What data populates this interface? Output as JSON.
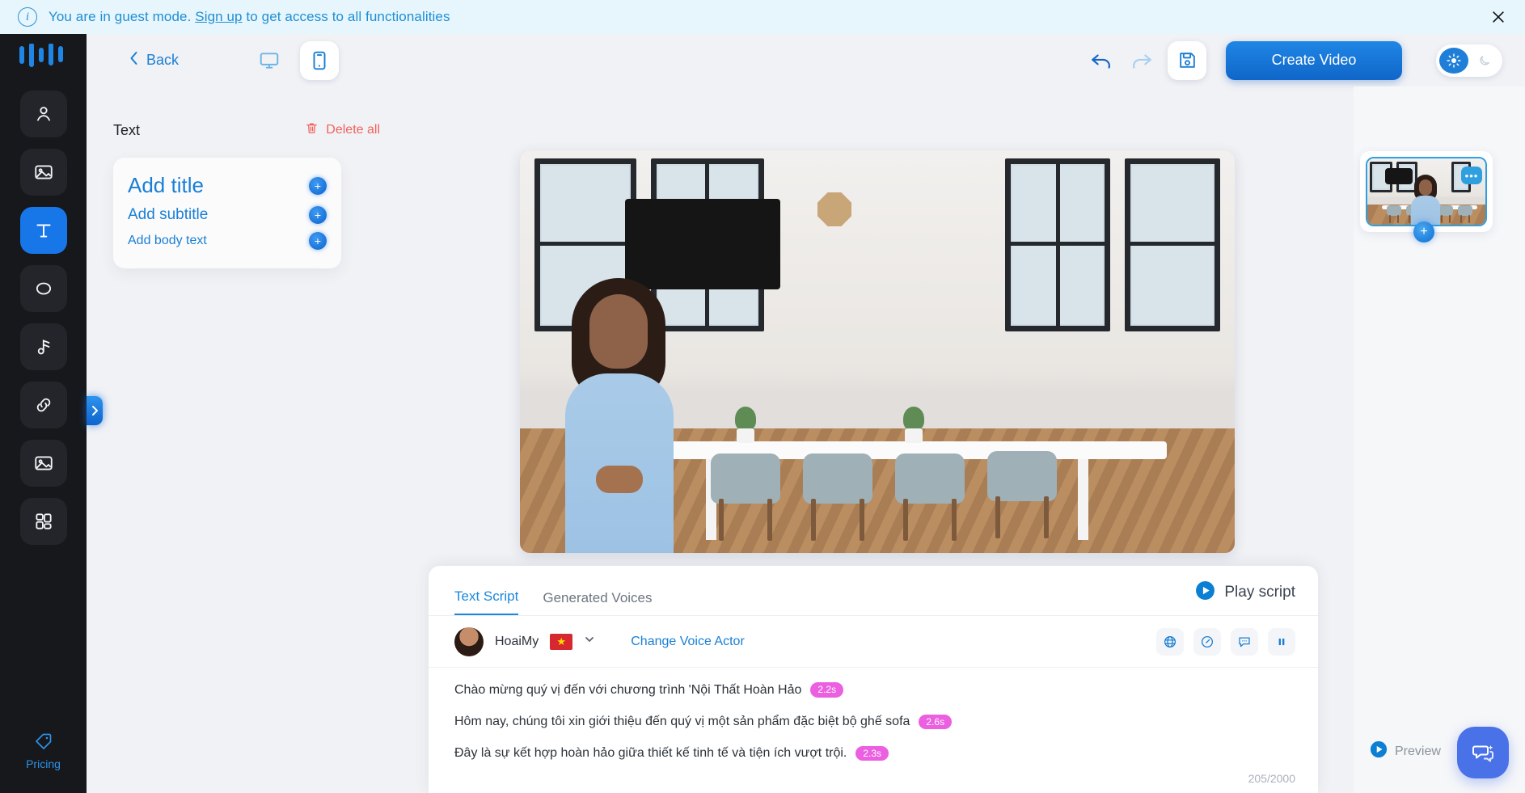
{
  "banner": {
    "icon": "info-icon",
    "text_before": "You are in guest mode. ",
    "link": "Sign up",
    "text_after": " to get access to all functionalities",
    "close_icon": "close-icon",
    "bg": "#e7f5fd",
    "fg": "#1f8fd4"
  },
  "rail": {
    "logo": "waveform-logo",
    "items": [
      {
        "name": "avatar-icon",
        "label": "Avatar",
        "active": false
      },
      {
        "name": "image-icon",
        "label": "Background",
        "active": false
      },
      {
        "name": "text-icon",
        "label": "Text",
        "active": true
      },
      {
        "name": "shape-icon",
        "label": "Shape",
        "active": false
      },
      {
        "name": "music-icon",
        "label": "Music",
        "active": false
      },
      {
        "name": "link-icon",
        "label": "Link",
        "active": false
      },
      {
        "name": "media-icon",
        "label": "Media",
        "active": false
      },
      {
        "name": "apps-icon",
        "label": "Elements",
        "active": false
      }
    ],
    "bottom": {
      "icon": "price-tag-icon",
      "label": "Pricing",
      "color": "#2e92e8"
    }
  },
  "toolbar": {
    "back_label": "Back",
    "back_icon": "chevron-left-icon",
    "devices": [
      {
        "name": "desktop-icon",
        "selected": false
      },
      {
        "name": "mobile-icon",
        "selected": true
      }
    ],
    "undo_icon": "undo-icon",
    "redo_icon": "redo-icon",
    "save_icon": "save-icon",
    "create_video_label": "Create Video",
    "theme": {
      "light_icon": "sun-icon",
      "dark_icon": "moon-icon",
      "selected": "light"
    },
    "accent": "#1877e8"
  },
  "text_panel": {
    "title": "Text",
    "delete_all_label": "Delete all",
    "delete_icon": "trash-icon",
    "items": [
      {
        "label": "Add title",
        "add_icon": "plus-circle-icon"
      },
      {
        "label": "Add subtitle",
        "add_icon": "plus-circle-icon"
      },
      {
        "label": "Add body text",
        "add_icon": "plus-circle-icon"
      }
    ],
    "collapse_icon": "chevron-right-icon"
  },
  "script": {
    "tabs": [
      {
        "label": "Text Script",
        "active": true
      },
      {
        "label": "Generated Voices",
        "active": false
      }
    ],
    "play_script_label": "Play script",
    "play_icon": "play-circle-icon",
    "voice": {
      "avatar": "voice-actor-avatar",
      "name": "HoaiMy",
      "flag": "vietnam-flag",
      "flag_glyph": "★",
      "dropdown_icon": "chevron-down-icon",
      "change_label": "Change Voice Actor"
    },
    "tools": [
      {
        "name": "translate-icon",
        "glyph": "globe"
      },
      {
        "name": "speed-icon",
        "glyph": "gauge"
      },
      {
        "name": "comment-icon",
        "glyph": "bubble"
      },
      {
        "name": "pause-icon",
        "glyph": "pause"
      }
    ],
    "lines": [
      {
        "text": "Chào mừng quý vị đến với chương trình 'Nội Thất Hoàn Hảo",
        "duration": "2.2s"
      },
      {
        "text": "Hôm nay, chúng tôi xin giới thiệu đến quý vị một sản phẩm đặc biệt bộ ghế sofa",
        "duration": "2.6s"
      },
      {
        "text": "Đây là sự kết hợp hoàn hảo giữa thiết kế tinh tế và tiện ích vượt trội.",
        "duration": "2.3s"
      }
    ],
    "counter": "205/2000",
    "duration_badge_color": "#eb5fe0"
  },
  "scenes": {
    "menu_icon": "scene-menu-dots",
    "menu_glyph": "•••",
    "add_scene_icon": "add-scene-button",
    "add_glyph": "+",
    "preview_label": "Preview",
    "preview_icon": "play-circle-icon",
    "chat_icon": "chat-support-icon"
  }
}
